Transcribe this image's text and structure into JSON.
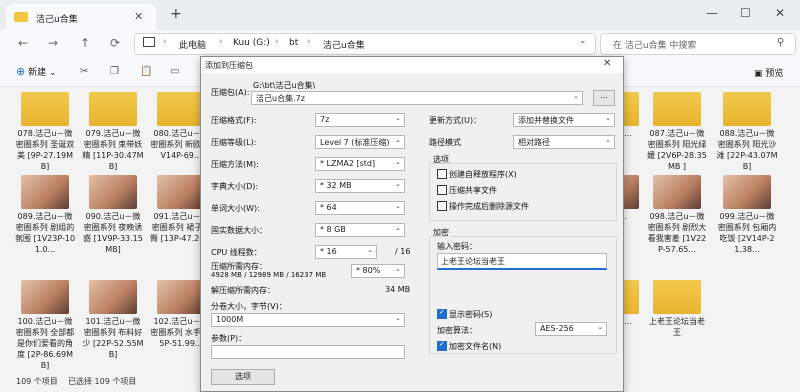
{
  "window": {
    "tab_title": "洁己u合集",
    "close_tab": "✕",
    "new_tab": "+",
    "minimize": "—",
    "maximize": "☐",
    "close": "✕"
  },
  "nav": {
    "back": "←",
    "forward": "→",
    "up": "↑",
    "refresh": "⟳"
  },
  "address": {
    "crumbs": [
      "此电脑",
      "Kuu (G:)",
      "bt",
      "洁己u合集"
    ],
    "sep": "›",
    "expand": "⌄"
  },
  "search": {
    "placeholder": "在 洁己u合集 中搜索"
  },
  "toolbar": {
    "new": "新建",
    "new_arrow": "⌄",
    "preview": "预览"
  },
  "files": {
    "left": [
      [
        "078.洁己u－微密圈系列 圣诞双美 [9P-27.19MB]",
        "079.洁己u－微密圈系列 束带妖精 [11P-30.47MB]",
        "080.洁己u－微密圈系列 新欧 [2V14P-69..."
      ],
      [
        "089.洁己u－微密圈系列 剧组的氛围 [1V23P-101.0...",
        "090.洁己u－微密圈系列 夜晚诱惑 [1V9P-33.15MB]",
        "091.洁己u－微密圈系列 裙子翘臀 [13P-47.20..."
      ],
      [
        "100.洁己u－微密圈系列 全部都是你们爱看的角度 [2P-86.69MB]",
        "101.洁己u－微密圈系列 布料好少 [22P-52.55MB]",
        "102.洁己u－微密圈系列 水手 [25P-51.99..."
      ]
    ],
    "right": [
      [
        "...红全 ...",
        "087.洁己u－微密圈系列 阳光绿媛 [2V6P-28.35MB ]",
        "088.洁己u－微密圈系列 阳光沙滩 [22P-43.07MB]"
      ],
      [
        "...趣...",
        "098.洁己u－微密圈系列 剧烈大看我害羞 [1V22P-57.65...",
        "099.洁己u－微密圈系列 包厢内吃饭 [2V14P-21.38..."
      ],
      [
        "...上的 ...",
        "上老王论坛当老王",
        ""
      ]
    ]
  },
  "status": {
    "count": "109 个项目",
    "selected": "已选择 109 个项目"
  },
  "dialog": {
    "title": "添加到压缩包",
    "archive_label": "压缩包(A):",
    "archive_path": "G:\\bt\\洁己u合集\\",
    "archive_name": "洁己u合集.7z",
    "browse": "...",
    "format_label": "压缩格式(F):",
    "format": "7z",
    "level_label": "压缩等级(L):",
    "level": "Level 7 (标准压缩)",
    "method_label": "压缩方法(M):",
    "method": "* LZMA2 [std]",
    "dict_label": "字典大小(D):",
    "dict": "* 32 MB",
    "word_label": "单词大小(W):",
    "word": "* 64",
    "solid_label": "固实数据大小：",
    "solid": "* 8 GB",
    "threads_label": "CPU 线程数：",
    "threads": "* 16",
    "threads_max": "/ 16",
    "mem_label": "压缩所需内存：",
    "mem_value": "4928 MB / 12989 MB / 16237 MB",
    "mem_pct": "* 80%",
    "decomp_label": "解压缩所需内存：",
    "decomp_value": "34 MB",
    "split_label": "分卷大小，字节(V)：",
    "split": "1000M",
    "params_label": "参数(P)：",
    "options_btn": "选项",
    "update_label": "更新方式(U)：",
    "update": "添加并替换文件",
    "path_label": "路径模式",
    "path": "相对路径",
    "options_group": "选项",
    "opt1": "创建自释放程序(X)",
    "opt2": "压缩共享文件",
    "opt3": "操作完成后删除源文件",
    "enc_group": "加密",
    "pw_label": "输入密码：",
    "password": "上老王论坛当老王",
    "show_pw": "显示密码(S)",
    "enc_method_label": "加密算法：",
    "enc_method": "AES-256",
    "enc_names": "加密文件名(N)",
    "arrow": "⌄"
  }
}
